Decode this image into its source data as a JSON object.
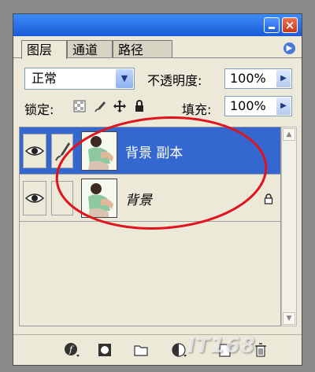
{
  "tabs": [
    {
      "label": "图层",
      "active": true
    },
    {
      "label": "通道",
      "active": false
    },
    {
      "label": "路径",
      "active": false
    }
  ],
  "blend_mode": {
    "value": "正常"
  },
  "opacity": {
    "label": "不透明度:",
    "value": "100%"
  },
  "lock": {
    "label": "锁定:"
  },
  "fill": {
    "label": "填充:",
    "value": "100%"
  },
  "layers": [
    {
      "name": "背景 副本",
      "selected": true,
      "visible": true
    },
    {
      "name": "背景",
      "selected": false,
      "visible": true,
      "locked": true
    }
  ],
  "watermark": "IT168",
  "colors": {
    "selection": "#3468d0",
    "panel_bg": "#ece9d8",
    "annotation_ellipse": "#e0141e"
  }
}
